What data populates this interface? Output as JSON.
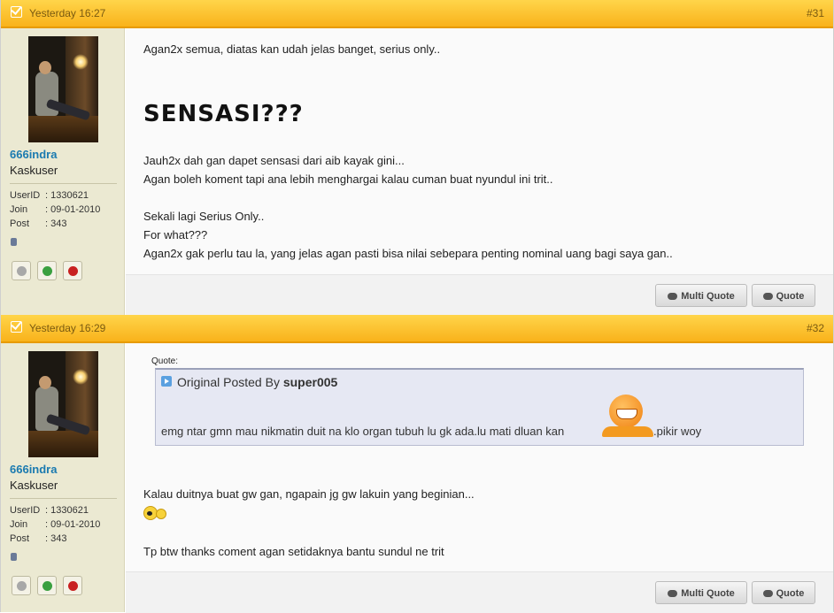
{
  "posts": [
    {
      "date": "Yesterday 16:27",
      "number": "#31",
      "user": {
        "name": "666indra",
        "title": "Kaskuser",
        "userid_label": "UserID",
        "userid": ": 1330621",
        "join_label": "Join",
        "join": ": 09-01-2010",
        "post_label": "Post",
        "post": ": 343"
      },
      "lines": {
        "l1": "Agan2x semua, diatas kan udah jelas banget, serius only..",
        "big": "SENSASI???",
        "l2": "Jauh2x dah gan dapet sensasi dari aib kayak gini...",
        "l3": "Agan boleh koment tapi ana lebih menghargai kalau cuman buat nyundul ini trit..",
        "l4": "Sekali lagi Serius Only..",
        "l5": "For what???",
        "l6": "Agan2x gak perlu tau la, yang jelas agan pasti bisa nilai sebepara penting nominal uang bagi saya gan.."
      },
      "buttons": {
        "multi_quote": "Multi Quote",
        "quote": "Quote"
      }
    },
    {
      "date": "Yesterday 16:29",
      "number": "#32",
      "user": {
        "name": "666indra",
        "title": "Kaskuser",
        "userid_label": "UserID",
        "userid": ": 1330621",
        "join_label": "Join",
        "join": ": 09-01-2010",
        "post_label": "Post",
        "post": ": 343"
      },
      "quote": {
        "label": "Quote:",
        "posted_by_prefix": "Original Posted By ",
        "author": "super005",
        "text_before": "emg ntar gmn mau nikmatin duit na klo organ tubuh lu gk ada.lu mati dluan kan",
        "text_after": ".pikir woy"
      },
      "lines": {
        "l1": "Kalau duitnya buat gw gan, ngapain jg gw lakuin yang beginian...",
        "l2": "Tp btw thanks coment agan setidaknya bantu sundul ne trit"
      },
      "buttons": {
        "multi_quote": "Multi Quote",
        "quote": "Quote"
      }
    }
  ],
  "colors": {
    "header_bar": "#f9b21b",
    "username": "#1a7ab0",
    "sidebar": "#ebe9d2"
  },
  "icons": [
    "checkbox-icon",
    "status-icon",
    "offline-icon",
    "add-reputation-icon",
    "report-icon",
    "quote-bubble-icon",
    "grin-smiley-icon",
    "shout-smiley-icon"
  ]
}
